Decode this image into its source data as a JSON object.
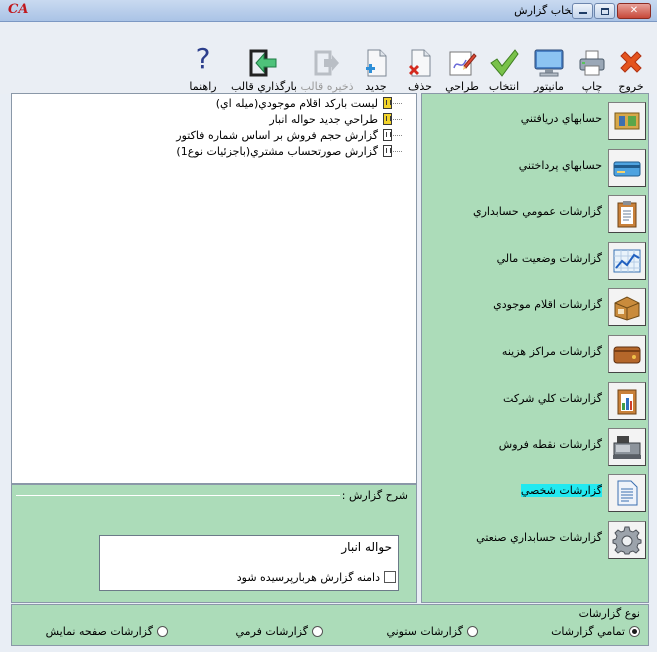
{
  "window": {
    "app_logo": "CA",
    "title": "انتخاب گزارش",
    "close_glyph": "✕"
  },
  "toolbar": {
    "exit": "خروج",
    "print": "چاپ",
    "monitor": "مانيتور",
    "select": "انتخاب",
    "design": "طراحي",
    "delete": "حذف",
    "new": "جديد",
    "save_template": "ذخيره قالب",
    "load_template": "بارگذاري قالب",
    "help": "راهنما",
    "help_glyph": "?"
  },
  "tree": {
    "items": [
      {
        "label": "ليست باركد اقلام موجودي(ميله اي)",
        "icon": "report-yellow-icon"
      },
      {
        "label": "طراحي جديد حواله انبار",
        "icon": "report-yellow-icon"
      },
      {
        "label": "گزارش حجم فروش بر اساس شماره فاكتور",
        "icon": "report-white-icon"
      },
      {
        "label": "گزارش صورتحساب مشتري(باجزئيات نوع1)",
        "icon": "report-white-icon"
      }
    ]
  },
  "description": {
    "caption": "شرح گزارش :",
    "text": "حواله انبار",
    "checkbox_label": "دامنه گزارش هربارپرسيده شود"
  },
  "categories": {
    "items": [
      {
        "label": "حسابهاي دريافتني",
        "icon": "receivables-icon"
      },
      {
        "label": "حسابهاي پرداختني",
        "icon": "payables-icon"
      },
      {
        "label": "گزارشات عمومي حسابداري",
        "icon": "clipboard-icon"
      },
      {
        "label": "گزارشات وضعيت مالي",
        "icon": "line-chart-icon"
      },
      {
        "label": "گزارشات اقلام موجودي",
        "icon": "inventory-box-icon"
      },
      {
        "label": "گزارشات مراكز هزينه",
        "icon": "wallet-icon"
      },
      {
        "label": "گزارشات كلي شركت",
        "icon": "bar-chart-icon"
      },
      {
        "label": "گزارشات نقطه فروش",
        "icon": "cash-register-icon"
      },
      {
        "label": "گزارشات شخصي",
        "icon": "personal-report-icon",
        "selected": true
      },
      {
        "label": "گزارشات حسابداري صنعتي",
        "icon": "gear-icon"
      }
    ]
  },
  "report_types": {
    "caption": "نوع گزارشات",
    "options": [
      {
        "label": "تمامي گزارشات",
        "selected": true
      },
      {
        "label": "گزارشات ستوني",
        "selected": false
      },
      {
        "label": "گزارشات فرمي",
        "selected": false
      },
      {
        "label": "گزارشات صفحه نمايش",
        "selected": false
      }
    ]
  },
  "colors": {
    "panel_green": "#acdcb9",
    "highlight_cyan": "#22e9f0",
    "close_red": "#c7483a"
  }
}
